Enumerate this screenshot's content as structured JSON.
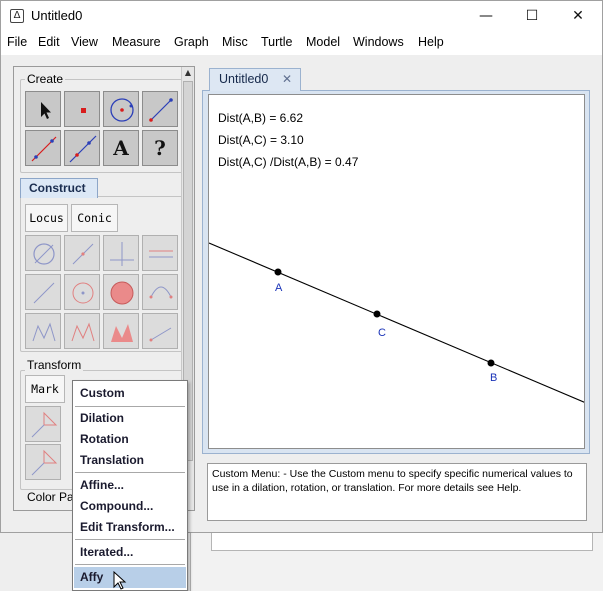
{
  "window": {
    "title": "Untitled0",
    "controls": [
      "—",
      "☐",
      "✕"
    ]
  },
  "menubar": [
    "File",
    "Edit",
    "View",
    "Measure",
    "Graph",
    "Misc",
    "Turtle",
    "Model",
    "Windows",
    "Help"
  ],
  "left_panel": {
    "create_title": "Create",
    "construct_tab": "Construct",
    "locus_label": "Locus",
    "conic_label": "Conic",
    "transform_title": "Transform",
    "mark_label": "Mark",
    "color_palette_title": "Color Pa",
    "text_tool_glyph": "A",
    "help_tool_glyph": "?"
  },
  "document": {
    "tab_label": "Untitled0",
    "tab_close": "✕",
    "measurements": [
      "Dist(A,B) = 6.62",
      "Dist(A,C) = 3.10",
      "Dist(A,C) /Dist(A,B)  = 0.47"
    ],
    "points": [
      {
        "label": "A"
      },
      {
        "label": "C"
      },
      {
        "label": "B"
      }
    ],
    "label_color": "#1a33b8"
  },
  "help_text": "Custom Menu: - Use the Custom menu to specify specific numerical values to use in a dilation, rotation, or translation. For more details see Help.",
  "popup_menu": {
    "items": [
      {
        "label": "Custom",
        "selected": false
      },
      {
        "label": "Dilation",
        "selected": false
      },
      {
        "label": "Rotation",
        "selected": false
      },
      {
        "label": "Translation",
        "selected": false
      },
      {
        "label": "Affine...",
        "selected": false
      },
      {
        "label": "Compound...",
        "selected": false
      },
      {
        "label": "Edit Transform...",
        "selected": false
      },
      {
        "label": "Iterated...",
        "selected": false
      },
      {
        "label": "Affy",
        "selected": true
      }
    ],
    "selected_color": "#b8cfe8"
  }
}
